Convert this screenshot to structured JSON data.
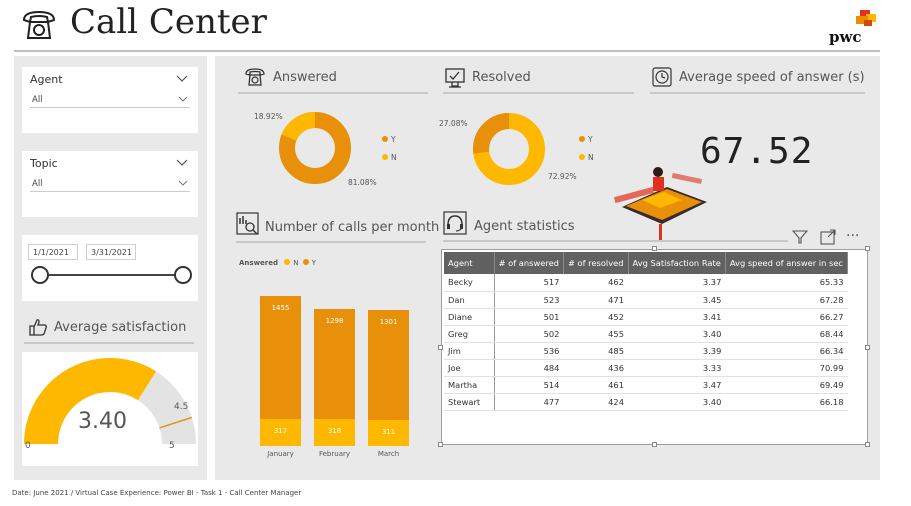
{
  "header": {
    "title": "Call Center",
    "brand": "pwc",
    "brand_colors": [
      "#e0301e",
      "#eb8c00",
      "#ffb600",
      "#d04a02"
    ]
  },
  "colors": {
    "accent_dark": "#e8900a",
    "accent_light": "#ffb800",
    "panel_bg": "#e9e9e9",
    "table_header": "#616161"
  },
  "filters": {
    "agent": {
      "label": "Agent",
      "value": "All"
    },
    "topic": {
      "label": "Topic",
      "value": "All"
    },
    "date_start": "1/1/2021",
    "date_end": "3/31/2021"
  },
  "satisfaction": {
    "title": "Average satisfaction",
    "value": "3.40",
    "target": "4.5",
    "min": "0",
    "max": "5",
    "level": 3.4
  },
  "answered": {
    "title": "Answered",
    "pct_small": "18.92%",
    "pct_large": "81.08%",
    "legend": [
      "Y",
      "N"
    ]
  },
  "resolved": {
    "title": "Resolved",
    "pct_small": "27.08%",
    "pct_large": "72.92%",
    "legend": [
      "Y",
      "N"
    ]
  },
  "speed": {
    "title": "Average speed of answer (s)",
    "value": "67.52"
  },
  "calls_per_month": {
    "title": "Number of calls per month",
    "legend_title": "Answered",
    "legend": [
      "N",
      "Y"
    ]
  },
  "chart_data": {
    "type": "bar",
    "categories": [
      "January",
      "February",
      "March"
    ],
    "series": [
      {
        "name": "N",
        "values": [
          317,
          318,
          311
        ]
      },
      {
        "name": "Y",
        "values": [
          1455,
          1298,
          1301
        ]
      }
    ],
    "xlabel": "",
    "ylabel": ""
  },
  "agent_stats": {
    "title": "Agent statistics",
    "columns": [
      "Agent",
      "# of answered",
      "# of resolved",
      "Avg Satisfaction Rate",
      "Avg speed of answer in sec"
    ],
    "rows": [
      [
        "Becky",
        "517",
        "462",
        "3.37",
        "65.33"
      ],
      [
        "Dan",
        "523",
        "471",
        "3.45",
        "67.28"
      ],
      [
        "Diane",
        "501",
        "452",
        "3.41",
        "66.27"
      ],
      [
        "Greg",
        "502",
        "455",
        "3.40",
        "68.44"
      ],
      [
        "Jim",
        "536",
        "485",
        "3.39",
        "66.34"
      ],
      [
        "Joe",
        "484",
        "436",
        "3.33",
        "70.99"
      ],
      [
        "Martha",
        "514",
        "461",
        "3.47",
        "69.49"
      ],
      [
        "Stewart",
        "477",
        "424",
        "3.40",
        "66.18"
      ]
    ]
  },
  "footer": "Date: June 2021 / Virtual Case Experience: Power BI - Task 1 - Call Center Manager"
}
